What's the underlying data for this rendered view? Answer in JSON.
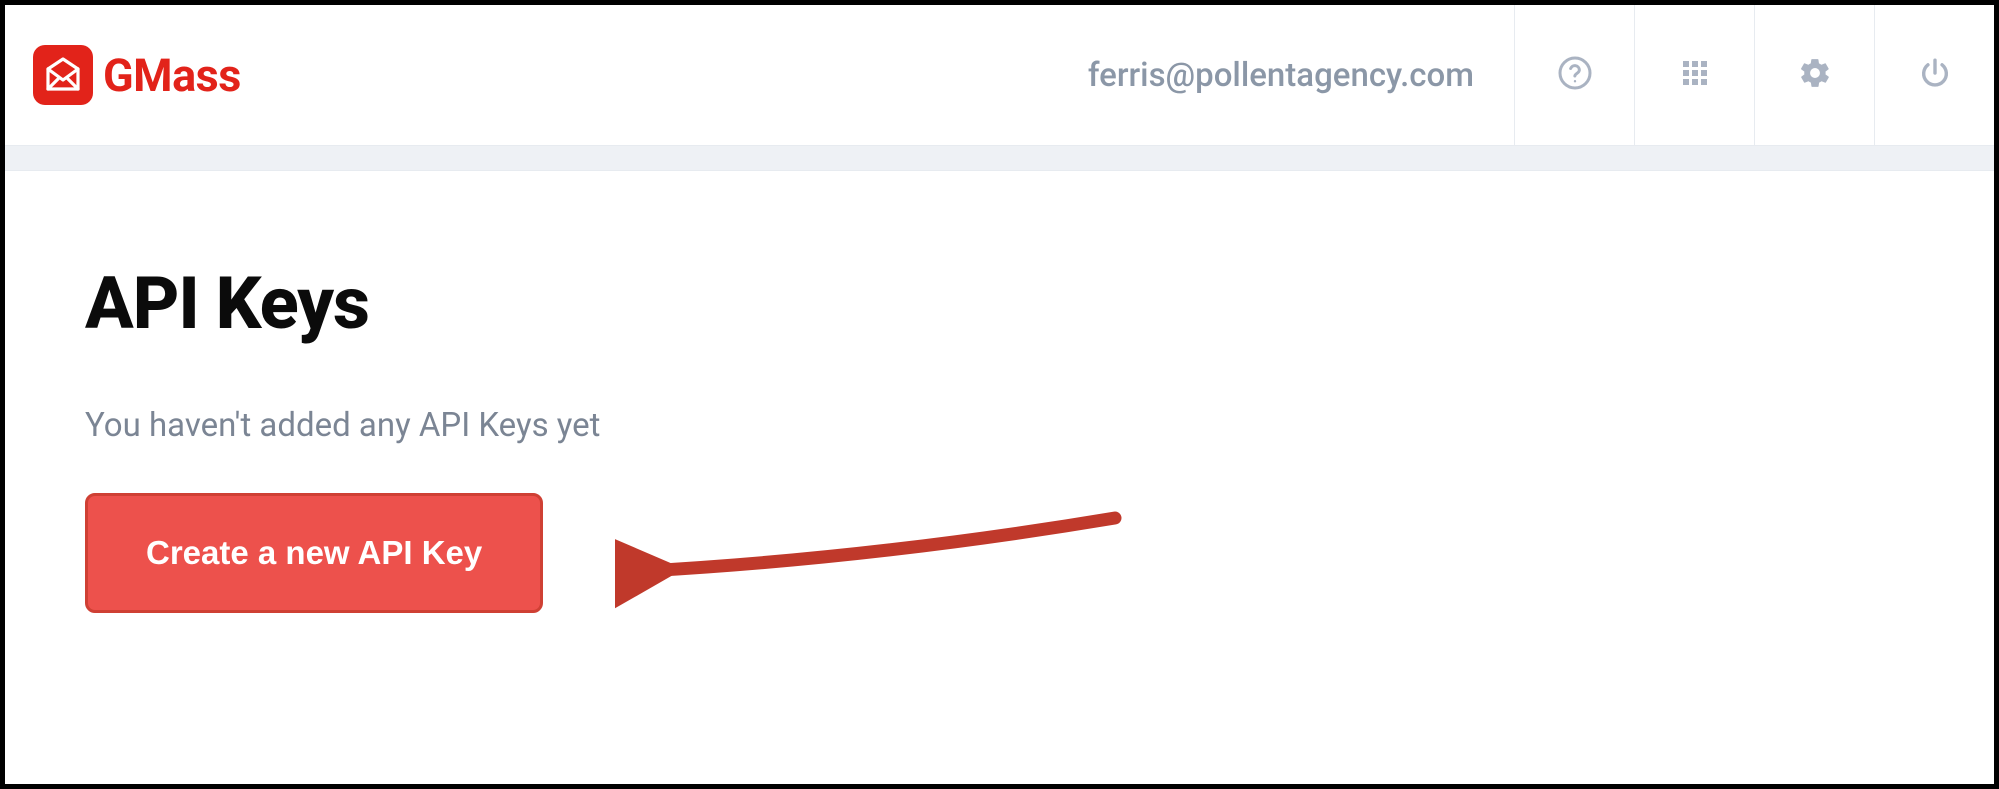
{
  "header": {
    "brand_name": "GMass",
    "user_email": "ferris@pollentagency.com"
  },
  "main": {
    "title": "API Keys",
    "empty_message": "You haven't added any API Keys yet",
    "create_button_label": "Create a new API Key"
  },
  "colors": {
    "brand_red": "#e2231a",
    "button_red": "#ed514c",
    "button_border": "#cf4034",
    "muted_text": "#8b97a7",
    "icon_gray": "#aab3c2"
  }
}
